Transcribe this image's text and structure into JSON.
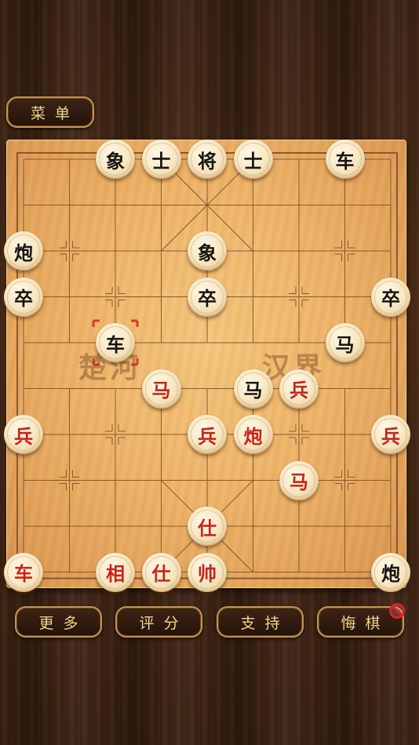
{
  "menu": {
    "label": "菜单"
  },
  "river": {
    "left": "楚河",
    "right": "汉界"
  },
  "bottom_buttons": [
    {
      "name": "more-button",
      "label": "更多"
    },
    {
      "name": "score-button",
      "label": "评分"
    },
    {
      "name": "support-button",
      "label": "支持"
    },
    {
      "name": "undo-button",
      "label": "悔棋"
    }
  ],
  "colors": {
    "black_piece": "#1a1410",
    "red_piece": "#c8231b",
    "button_text": "#f2d48e"
  },
  "pieces": [
    {
      "label": "象",
      "side": "black",
      "col": 2,
      "row": 0
    },
    {
      "label": "士",
      "side": "black",
      "col": 3,
      "row": 0
    },
    {
      "label": "将",
      "side": "black",
      "col": 4,
      "row": 0
    },
    {
      "label": "士",
      "side": "black",
      "col": 5,
      "row": 0
    },
    {
      "label": "车",
      "side": "black",
      "col": 7,
      "row": 0
    },
    {
      "label": "炮",
      "side": "black",
      "col": 0,
      "row": 2
    },
    {
      "label": "象",
      "side": "black",
      "col": 4,
      "row": 2
    },
    {
      "label": "卒",
      "side": "black",
      "col": 0,
      "row": 3
    },
    {
      "label": "卒",
      "side": "black",
      "col": 4,
      "row": 3
    },
    {
      "label": "卒",
      "side": "black",
      "col": 8,
      "row": 3
    },
    {
      "label": "车",
      "side": "black",
      "col": 2,
      "row": 4
    },
    {
      "label": "马",
      "side": "black",
      "col": 7,
      "row": 4
    },
    {
      "label": "马",
      "side": "red",
      "col": 3,
      "row": 5
    },
    {
      "label": "马",
      "side": "black",
      "col": 5,
      "row": 5
    },
    {
      "label": "兵",
      "side": "red",
      "col": 6,
      "row": 5
    },
    {
      "label": "兵",
      "side": "red",
      "col": 0,
      "row": 6
    },
    {
      "label": "兵",
      "side": "red",
      "col": 4,
      "row": 6
    },
    {
      "label": "炮",
      "side": "red",
      "col": 5,
      "row": 6
    },
    {
      "label": "兵",
      "side": "red",
      "col": 8,
      "row": 6
    },
    {
      "label": "马",
      "side": "red",
      "col": 6,
      "row": 7
    },
    {
      "label": "仕",
      "side": "red",
      "col": 4,
      "row": 8
    },
    {
      "label": "车",
      "side": "red",
      "col": 0,
      "row": 9
    },
    {
      "label": "相",
      "side": "red",
      "col": 2,
      "row": 9
    },
    {
      "label": "仕",
      "side": "red",
      "col": 3,
      "row": 9
    },
    {
      "label": "帅",
      "side": "red",
      "col": 4,
      "row": 9
    },
    {
      "label": "炮",
      "side": "black",
      "col": 8,
      "row": 9
    }
  ],
  "last_move": {
    "col": 2,
    "row": 4
  }
}
